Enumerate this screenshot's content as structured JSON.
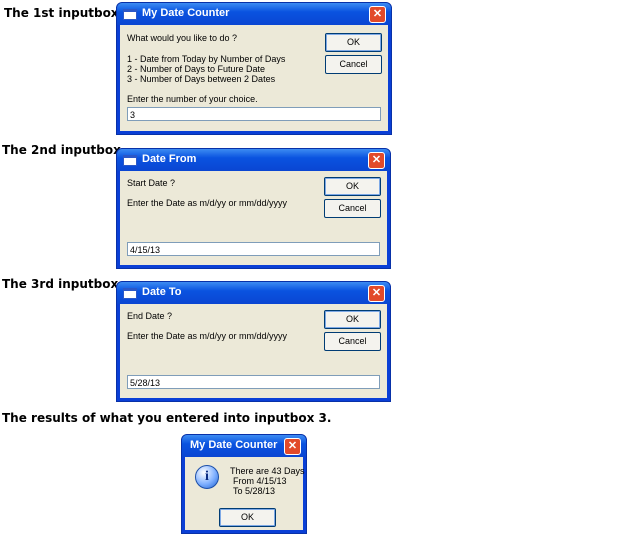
{
  "captions": {
    "box1": "The 1st inputbox.",
    "box2": "The 2nd inputbox.",
    "box3": "The 3rd inputbox.",
    "result": "The results of what you entered into inputbox 3."
  },
  "dialog1": {
    "title": "My Date Counter",
    "prompt_line1": "What would you like to do ?",
    "option1": "1 - Date from Today by Number of Days",
    "option2": "2 - Number of Days to Future Date",
    "option3": "3 - Number of Days between 2 Dates",
    "instruction": "Enter the number of your choice.",
    "input_value": "3",
    "ok_label": "OK",
    "cancel_label": "Cancel",
    "close_glyph": "✕"
  },
  "dialog2": {
    "title": "Date From",
    "prompt_line1": "Start Date ?",
    "instruction": "Enter the Date as m/d/yy or mm/dd/yyyy",
    "input_value": "4/15/13",
    "ok_label": "OK",
    "cancel_label": "Cancel",
    "close_glyph": "✕"
  },
  "dialog3": {
    "title": "Date To",
    "prompt_line1": "End Date ?",
    "instruction": "Enter the Date as m/d/yy or mm/dd/yyyy",
    "input_value": "5/28/13",
    "ok_label": "OK",
    "cancel_label": "Cancel",
    "close_glyph": "✕"
  },
  "result_dialog": {
    "title": "My Date Counter",
    "line1": "There are 43 Days",
    "line2": "From 4/15/13",
    "line3": "To 5/28/13",
    "icon_glyph": "i",
    "ok_label": "OK",
    "close_glyph": "✕"
  },
  "colors": {
    "titlebar": "#0a53e0",
    "client": "#ece9d8",
    "close_button": "#e24a2a"
  }
}
